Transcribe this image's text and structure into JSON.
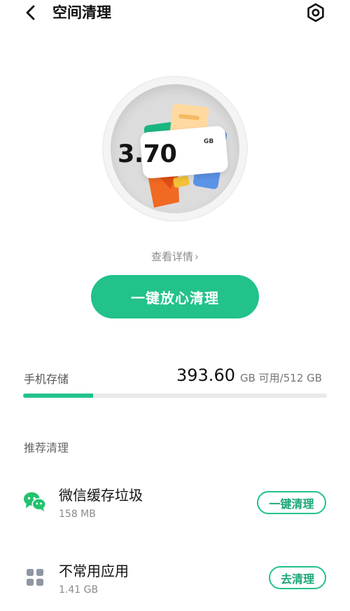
{
  "header": {
    "title": "空间清理",
    "back_icon": "back-arrow-icon",
    "settings_icon": "settings-gear-icon"
  },
  "hero": {
    "size_value": "3.70",
    "size_unit": "GB"
  },
  "detail_link": {
    "label": "查看详情",
    "chevron": "›"
  },
  "primary_button": {
    "label": "一键放心清理"
  },
  "storage": {
    "label": "手机存储",
    "available_value": "393.60",
    "available_suffix": "GB 可用/512 GB",
    "available_fraction": 0.23,
    "accent": "#22c28a"
  },
  "recommended": {
    "section_title": "推荐清理",
    "items": [
      {
        "icon": "wechat-icon",
        "title": "微信缓存垃圾",
        "size": "158 MB",
        "action_label": "一键清理"
      },
      {
        "icon": "apps-grid-icon",
        "title": "不常用应用",
        "size": "1.41 GB",
        "action_label": "去清理"
      }
    ]
  }
}
